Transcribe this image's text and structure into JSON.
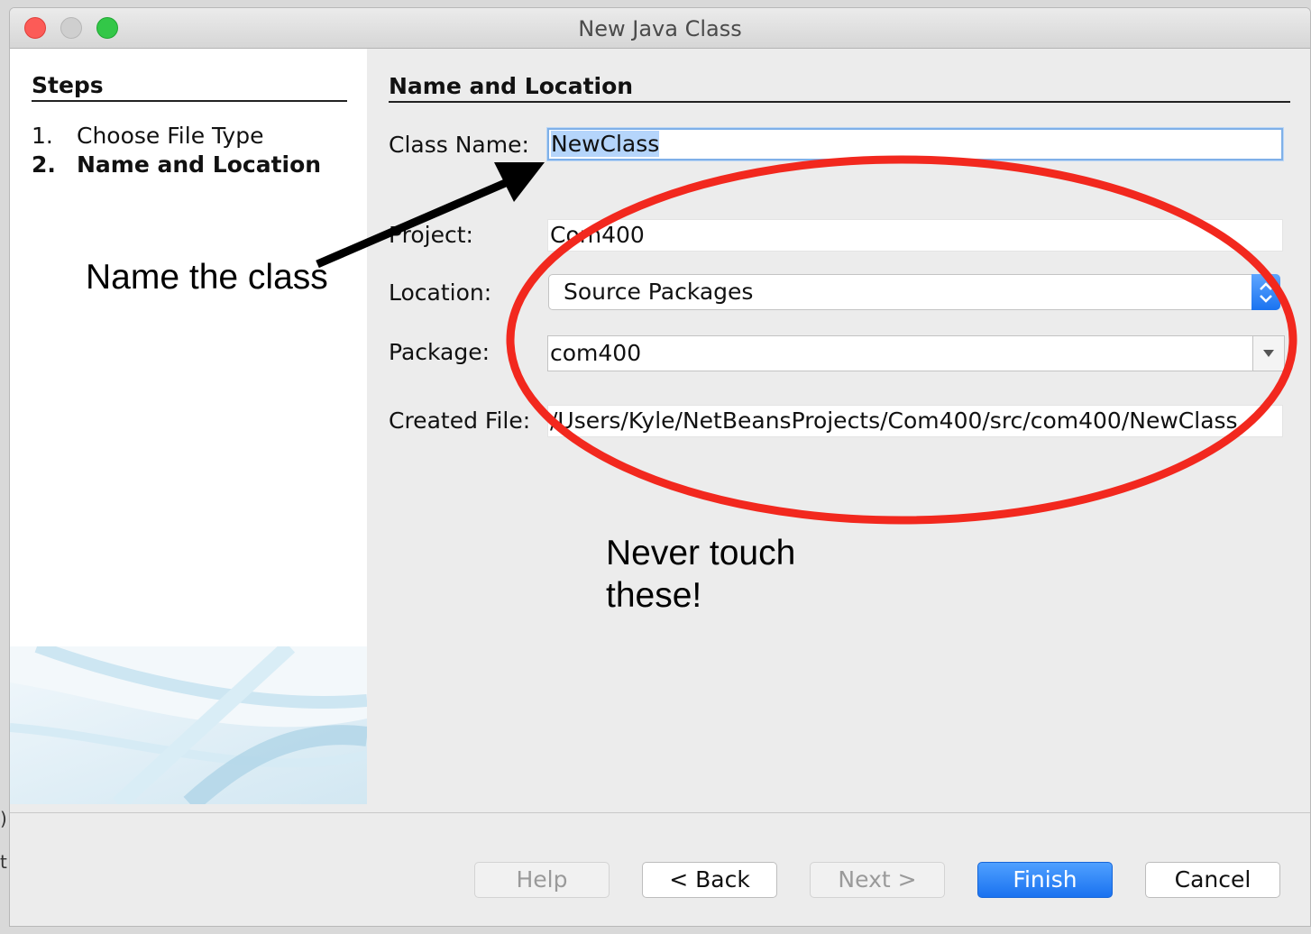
{
  "window": {
    "title": "New Java Class"
  },
  "steps": {
    "title": "Steps",
    "items": [
      {
        "num": "1.",
        "label": "Choose File Type"
      },
      {
        "num": "2.",
        "label": "Name and Location"
      }
    ]
  },
  "form": {
    "title": "Name and Location",
    "class_name": {
      "label": "Class Name:",
      "value": "NewClass"
    },
    "project": {
      "label": "Project:",
      "value": "Com400"
    },
    "location": {
      "label": "Location:",
      "value": "Source Packages"
    },
    "package": {
      "label": "Package:",
      "value": "com400"
    },
    "created_file": {
      "label": "Created File:",
      "value": "/Users/Kyle/NetBeansProjects/Com400/src/com400/NewClass."
    }
  },
  "buttons": {
    "help": "Help",
    "back": "< Back",
    "next": "Next >",
    "finish": "Finish",
    "cancel": "Cancel"
  },
  "annotations": {
    "name_class": "Name the class",
    "never_touch_line1": "Never touch",
    "never_touch_line2": "these!"
  },
  "colors": {
    "accent_blue": "#1a72f0",
    "annotation_red": "#f2281e",
    "selection": "#b5d5fb"
  }
}
